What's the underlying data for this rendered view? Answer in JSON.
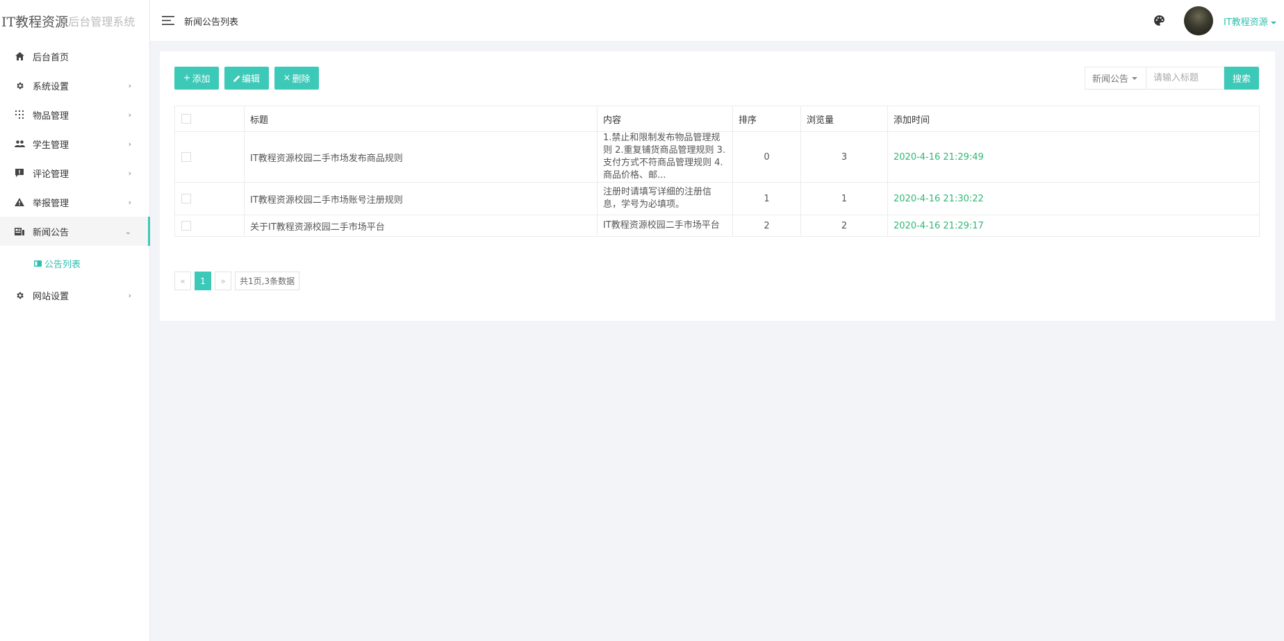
{
  "brand": {
    "primary": "IT教程资源",
    "secondary": "后台管理系统"
  },
  "header": {
    "title": "新闻公告列表",
    "user_name": "IT教程资源"
  },
  "sidebar": {
    "items": [
      {
        "label": "后台首页",
        "icon": "home-icon"
      },
      {
        "label": "系统设置",
        "icon": "gear-icon"
      },
      {
        "label": "物品管理",
        "icon": "grid-dots-icon"
      },
      {
        "label": "学生管理",
        "icon": "users-icon"
      },
      {
        "label": "评论管理",
        "icon": "comment-alert-icon"
      },
      {
        "label": "举报管理",
        "icon": "warning-icon"
      },
      {
        "label": "新闻公告",
        "icon": "news-icon"
      },
      {
        "label": "网站设置",
        "icon": "gear-icon"
      }
    ],
    "submenu": {
      "label": "公告列表",
      "icon": "card-icon"
    }
  },
  "toolbar": {
    "add_label": "添加",
    "edit_label": "编辑",
    "delete_label": "删除"
  },
  "search": {
    "category": "新闻公告",
    "placeholder": "请输入标题",
    "button_label": "搜索"
  },
  "table": {
    "columns": [
      "标题",
      "内容",
      "排序",
      "浏览量",
      "添加时间"
    ],
    "rows": [
      {
        "title": "IT教程资源校园二手市场发布商品规则",
        "content": "1.禁止和限制发布物品管理规则 2.重复铺货商品管理规则 3.支付方式不符商品管理规则 4.商品价格、邮...",
        "order": "0",
        "views": "3",
        "time": "2020-4-16 21:29:49"
      },
      {
        "title": "IT教程资源校园二手市场账号注册规则",
        "content": "注册时请填写详细的注册信息，学号为必填项。",
        "order": "1",
        "views": "1",
        "time": "2020-4-16 21:30:22"
      },
      {
        "title": "关于IT教程资源校园二手市场平台",
        "content": "IT教程资源校园二手市场平台",
        "order": "2",
        "views": "2",
        "time": "2020-4-16 21:29:17"
      }
    ]
  },
  "pagination": {
    "prev": "«",
    "current": "1",
    "next": "»",
    "info": "共1页,3条数据"
  },
  "colors": {
    "accent": "#3cc9b8",
    "time_text": "#2eb873",
    "link": "#2fbfae"
  }
}
